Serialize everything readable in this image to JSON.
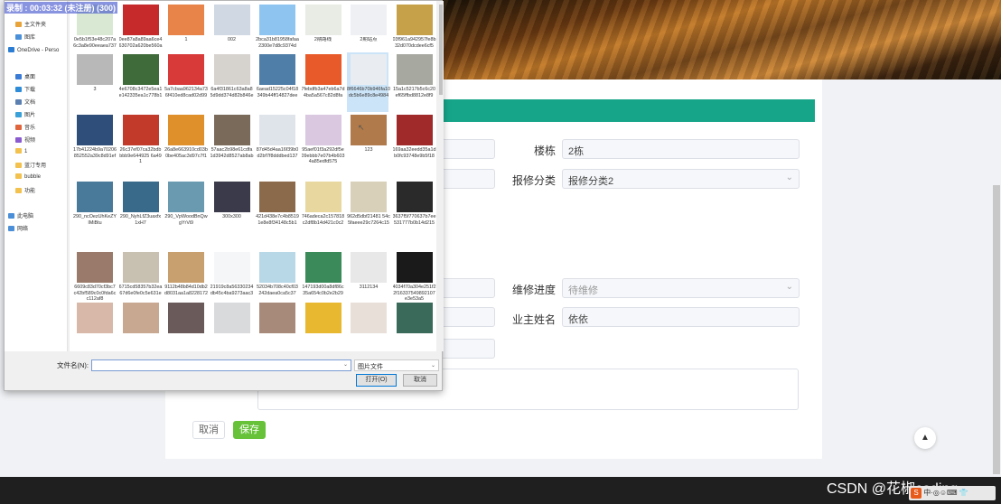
{
  "form": {
    "building_label": "楼栋",
    "building_value": "2栋",
    "category_label": "报修分类",
    "category_value": "报修分类2",
    "progress_label": "维修进度",
    "progress_placeholder": "待维修",
    "owner_label": "业主姓名",
    "owner_value": "依依",
    "cancel_label": "取消",
    "save_label": "保存"
  },
  "watermark": "CSDN @花椒coding",
  "tray_icons": "中·◎☺⌨ 👕",
  "dialog": {
    "recording_overlay": "录制 : 00:03:32 (未注册) (300)",
    "nav_items": [
      {
        "label": "主文件夹",
        "icon": "home-icon",
        "color": "#e8a33b"
      },
      {
        "label": "图库",
        "icon": "gallery-icon",
        "color": "#4a90d9"
      },
      {
        "label": "OneDrive - Perso",
        "icon": "onedrive-icon",
        "color": "#2b7cd3"
      },
      {
        "label": "桌面",
        "icon": "desktop-icon",
        "color": "#3a7bd5"
      },
      {
        "label": "下载",
        "icon": "download-icon",
        "color": "#2e8bd8"
      },
      {
        "label": "文档",
        "icon": "documents-icon",
        "color": "#5b7fb0"
      },
      {
        "label": "图片",
        "icon": "pictures-icon",
        "color": "#3aa0d8"
      },
      {
        "label": "音乐",
        "icon": "music-icon",
        "color": "#e0643c"
      },
      {
        "label": "视频",
        "icon": "videos-icon",
        "color": "#8a5bd0"
      },
      {
        "label": "1",
        "icon": "folder-icon",
        "color": "#f2c14e"
      },
      {
        "label": "蓝汀专用",
        "icon": "folder-icon",
        "color": "#f2c14e"
      },
      {
        "label": "bubble",
        "icon": "folder-icon",
        "color": "#f2c14e"
      },
      {
        "label": "功能",
        "icon": "folder-icon",
        "color": "#f2c14e"
      },
      {
        "label": "此电脑",
        "icon": "this-pc-icon",
        "color": "#4a8fd8"
      },
      {
        "label": "网络",
        "icon": "network-icon",
        "color": "#4a8fd8"
      }
    ],
    "files": [
      {
        "name": "0e5b1f53e48c207a6c3a8e90eeaea737",
        "color": "#d9e8d3"
      },
      {
        "name": "0ee87a8a89aa6ce4630702a620be560a",
        "color": "#c62a2a"
      },
      {
        "name": "1",
        "color": "#e8844a"
      },
      {
        "name": "002",
        "color": "#cfd8e3"
      },
      {
        "name": "2bca31b81958fafaa2300e7d8c9374d",
        "color": "#8ec5f0"
      },
      {
        "name": "2期路线",
        "color": "#e8ece4"
      },
      {
        "name": "2期站点",
        "color": "#eef0f4"
      },
      {
        "name": "03f961a942957fe8b32d070dcdee6cf5",
        "color": "#c7a14a"
      },
      {
        "name": "3",
        "color": "#b8b8b8"
      },
      {
        "name": "4e6708c3472e5ea1e142335ea1c778b1",
        "color": "#3f6b3a"
      },
      {
        "name": "5a7cbaa962134a736f410ed8cad02d99",
        "color": "#d83a3a"
      },
      {
        "name": "6a4f31861c63a8a85d9dd374d82b846e",
        "color": "#d6d3cf"
      },
      {
        "name": "6aead15225c04f18349b44ff14827dee",
        "color": "#4f7ea8"
      },
      {
        "name": "7febdfb3a47eb6a7d4ba5a567c82d8fa",
        "color": "#e85a2a"
      },
      {
        "name": "8f6646b70b946fa10dc5b6e89c8e4984",
        "color": "#e9edf2"
      },
      {
        "name": "15a1c5217b5c6c20ef65ffbd8812e8f9",
        "color": "#a7a8a0"
      },
      {
        "name": "17b41224b9a70206852552a39c8d91ef",
        "color": "#2f4f7a"
      },
      {
        "name": "26c37ef07ca32bdbbbb9e644925 6a491",
        "color": "#c23a2a"
      },
      {
        "name": "26a8e663910cd03b0be405ac3d97c7f1",
        "color": "#e0902a"
      },
      {
        "name": "57aac2b98e61cdfa1d3942d8527ab8ab",
        "color": "#7a6a5a"
      },
      {
        "name": "87d45d4aa16f39b0d2bf7f8dddbed137",
        "color": "#dfe4ea"
      },
      {
        "name": "95aef01f3a292df5e09ebbb7e07b4b6034a85edfd575",
        "color": "#d9c8e0"
      },
      {
        "name": "123",
        "color": "#b07a4a"
      },
      {
        "name": "169aa32eedd35a1db0fc93748e9b5f18",
        "color": "#a02a2a"
      },
      {
        "name": "290_ncOezUhKeZYIMiBtu",
        "color": "#4a7a9a"
      },
      {
        "name": "290_NyhLfZ3uaxfx1xH7",
        "color": "#3a6a8a"
      },
      {
        "name": "290_VpWoodBnQwgYrVi9",
        "color": "#6a9ab0"
      },
      {
        "name": "300x300",
        "color": "#3a3a4a"
      },
      {
        "name": "421d438e7c4b85191e8e8f34148c5b1",
        "color": "#8a6a4a"
      },
      {
        "name": "746adeca2c157818c2df8b14d421c0c2",
        "color": "#e8d8a0"
      },
      {
        "name": "962d5dbf21481 54c5faeee29c7264c15",
        "color": "#d8d0b8"
      },
      {
        "name": "3637f5f770637b7ee531777b0b14d215",
        "color": "#2a2a2a"
      },
      {
        "name": "6609c83d70cf3bc7c42bf589c0c0fda6cc112af8",
        "color": "#9a7a6a"
      },
      {
        "name": "6715cd58357b32ea67d6e0fe0c5e631e",
        "color": "#c8c0b0"
      },
      {
        "name": "9112b48b84d10db2d8031aa1a8228172",
        "color": "#c8a070"
      },
      {
        "name": "21919c8a56330234db45c4ba9273aac3",
        "color": "#f4f6f8"
      },
      {
        "name": "52034b708c40cf03242daea0ca5c37",
        "color": "#b8d8e8"
      },
      {
        "name": "147193d00a8df86c35a654c0b2e2b29",
        "color": "#3a8a5a"
      },
      {
        "name": "3112134",
        "color": "#e8e8e8"
      },
      {
        "name": "4034f70a304e251f22f16337549892107e3e53a5",
        "color": "#1a1a1a"
      },
      {
        "name": "",
        "color": "#d8b8a8"
      },
      {
        "name": "",
        "color": "#c8a890"
      },
      {
        "name": "",
        "color": "#6a5a5a"
      },
      {
        "name": "",
        "color": "#d8dadc"
      },
      {
        "name": "",
        "color": "#a88a7a"
      },
      {
        "name": "",
        "color": "#e8b830"
      },
      {
        "name": "",
        "color": "#e8e0d8"
      },
      {
        "name": "",
        "color": "#3a6a5a"
      }
    ],
    "selected_index": 14,
    "filename_label": "文件名(N):",
    "filename_value": "",
    "filetype_value": "图片文件",
    "open_label": "打开(O)",
    "cancel_label": "取消"
  }
}
